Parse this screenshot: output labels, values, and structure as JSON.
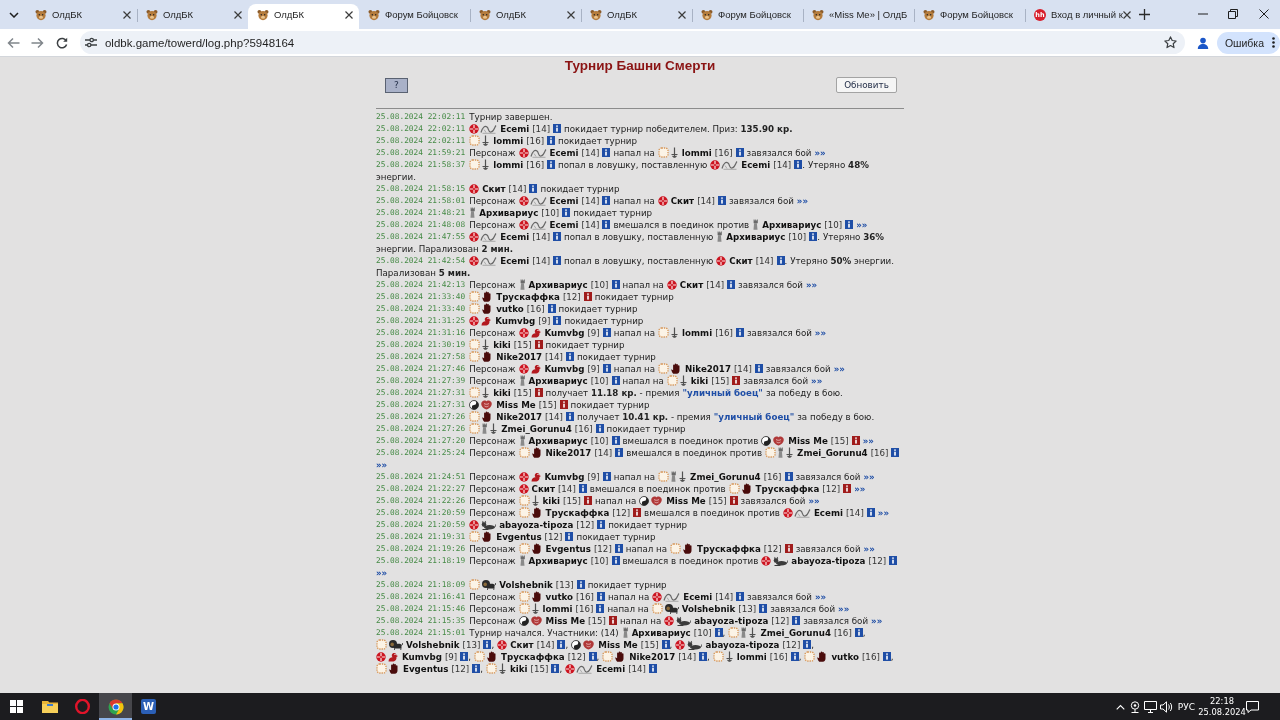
{
  "browser": {
    "tabs": [
      {
        "kind": "mascot",
        "title": "ОлдБК",
        "selected": false,
        "close": true
      },
      {
        "kind": "mascot",
        "title": "ОлдБК",
        "selected": false,
        "close": true
      },
      {
        "kind": "mascot",
        "title": "ОлдБК",
        "selected": true,
        "close": true
      },
      {
        "kind": "mascot",
        "title": "Форум Бойцовск",
        "selected": false,
        "close": false
      },
      {
        "kind": "mascot",
        "title": "ОлдБК",
        "selected": false,
        "close": true
      },
      {
        "kind": "mascot",
        "title": "ОлдБК",
        "selected": false,
        "close": true
      },
      {
        "kind": "mascot",
        "title": "Форум Бойцовск",
        "selected": false,
        "close": false
      },
      {
        "kind": "mascot",
        "title": "«Miss Me» | ОлдБ",
        "selected": false,
        "close": false
      },
      {
        "kind": "mascot",
        "title": "Форум Бойцовск",
        "selected": false,
        "close": false
      },
      {
        "kind": "badge",
        "logo": "hh",
        "title": "Вход в личный к",
        "selected": false,
        "close": true
      }
    ],
    "url": "oldbk.game/towerd/log.php?5948164",
    "profile_button": "Ошибка"
  },
  "page": {
    "title": "Турнир Башни Смерти",
    "help_button": "?",
    "refresh_button": "Обновить",
    "log": [
      {
        "time": "25.08.2024 22:02:11",
        "parts": [
          {
            "kind": "text",
            "text": "Турнир завершен."
          }
        ]
      },
      {
        "time": "25.08.2024 22:02:11",
        "parts": [
          {
            "kind": "player",
            "emblems": [
              {
                "kind": "cross"
              },
              {
                "kind": "venom"
              }
            ],
            "name": "Ecemi",
            "rank": "[14]",
            "color": "#1f4ea6"
          },
          {
            "kind": "text",
            "text": "покидает турнир победителем. Приз: **135.90 кр.**"
          }
        ]
      },
      {
        "time": "25.08.2024 22:02:11",
        "parts": [
          {
            "kind": "player",
            "emblems": [
              {
                "kind": "ring"
              },
              {
                "kind": "dagger"
              }
            ],
            "name": "lommi",
            "rank": "[16]",
            "color": "#1f4ea6"
          },
          {
            "kind": "text",
            "text": "покидает турнир"
          }
        ]
      },
      {
        "time": "25.08.2024 21:59:21",
        "parts": [
          {
            "kind": "text",
            "text": "Персонаж"
          },
          {
            "kind": "player",
            "emblems": [
              {
                "kind": "cross"
              },
              {
                "kind": "venom"
              }
            ],
            "name": "Ecemi",
            "rank": "[14]",
            "color": "#1f4ea6"
          },
          {
            "kind": "text",
            "text": "напал на"
          },
          {
            "kind": "player",
            "emblems": [
              {
                "kind": "ring"
              },
              {
                "kind": "dagger"
              }
            ],
            "name": "lommi",
            "rank": "[16]",
            "color": "#1f4ea6"
          },
          {
            "kind": "text",
            "text": "завязался бой"
          },
          {
            "kind": "link",
            "text": "»»"
          }
        ]
      },
      {
        "time": "25.08.2024 21:58:37",
        "parts": [
          {
            "kind": "player",
            "emblems": [
              {
                "kind": "ring"
              },
              {
                "kind": "dagger"
              }
            ],
            "name": "lommi",
            "rank": "[16]",
            "color": "#1f4ea6"
          },
          {
            "kind": "text",
            "text": "попал в ловушку, поставленную"
          },
          {
            "kind": "player",
            "emblems": [
              {
                "kind": "cross"
              },
              {
                "kind": "venom"
              }
            ],
            "name": "Ecemi",
            "rank": "[14]",
            "color": "#1f4ea6",
            "suffix": "."
          },
          {
            "kind": "text",
            "text": "Утеряно **48%**"
          },
          {
            "kind": "text",
            "text": "энергии."
          }
        ]
      },
      {
        "time": "25.08.2024 21:58:15",
        "parts": [
          {
            "kind": "player",
            "emblems": [
              {
                "kind": "cross"
              }
            ],
            "name": "Скит",
            "rank": "[14]",
            "color": "#1f4ea6"
          },
          {
            "kind": "text",
            "text": "покидает турнир"
          }
        ]
      },
      {
        "time": "25.08.2024 21:58:01",
        "parts": [
          {
            "kind": "text",
            "text": "Персонаж"
          },
          {
            "kind": "player",
            "emblems": [
              {
                "kind": "cross"
              },
              {
                "kind": "venom"
              }
            ],
            "name": "Ecemi",
            "rank": "[14]",
            "color": "#1f4ea6"
          },
          {
            "kind": "text",
            "text": "напал на"
          },
          {
            "kind": "player",
            "emblems": [
              {
                "kind": "cross"
              }
            ],
            "name": "Скит",
            "rank": "[14]",
            "color": "#1f4ea6"
          },
          {
            "kind": "text",
            "text": "завязался бой"
          },
          {
            "kind": "link",
            "text": "»»"
          }
        ]
      },
      {
        "time": "25.08.2024 21:48:21",
        "parts": [
          {
            "kind": "player",
            "emblems": [
              {
                "kind": "tower"
              }
            ],
            "name": "Архивариус",
            "rank": "[10]",
            "color": "#1f4ea6"
          },
          {
            "kind": "text",
            "text": "покидает турнир"
          }
        ]
      },
      {
        "time": "25.08.2024 21:48:08",
        "parts": [
          {
            "kind": "text",
            "text": "Персонаж"
          },
          {
            "kind": "player",
            "emblems": [
              {
                "kind": "cross"
              },
              {
                "kind": "venom"
              }
            ],
            "name": "Ecemi",
            "rank": "[14]",
            "color": "#1f4ea6"
          },
          {
            "kind": "text",
            "text": "вмешался в поединок против"
          },
          {
            "kind": "player",
            "emblems": [
              {
                "kind": "tower"
              }
            ],
            "name": "Архивариус",
            "rank": "[10]",
            "color": "#1f4ea6"
          },
          {
            "kind": "link",
            "text": "»»"
          }
        ]
      },
      {
        "time": "25.08.2024 21:47:55",
        "parts": [
          {
            "kind": "player",
            "emblems": [
              {
                "kind": "cross"
              },
              {
                "kind": "venom"
              }
            ],
            "name": "Ecemi",
            "rank": "[14]",
            "color": "#1f4ea6"
          },
          {
            "kind": "text",
            "text": "попал в ловушку, поставленную"
          },
          {
            "kind": "player",
            "emblems": [
              {
                "kind": "tower"
              }
            ],
            "name": "Архивариус",
            "rank": "[10]",
            "color": "#1f4ea6",
            "suffix": "."
          },
          {
            "kind": "text",
            "text": "Утеряно **36%**"
          },
          {
            "kind": "text",
            "text": "энергии. Парализован **2 мин.**"
          }
        ]
      },
      {
        "time": "25.08.2024 21:42:54",
        "parts": [
          {
            "kind": "player",
            "emblems": [
              {
                "kind": "cross"
              },
              {
                "kind": "venom"
              }
            ],
            "name": "Ecemi",
            "rank": "[14]",
            "color": "#1f4ea6"
          },
          {
            "kind": "text",
            "text": "попал в ловушку, поставленную"
          },
          {
            "kind": "player",
            "emblems": [
              {
                "kind": "cross"
              }
            ],
            "name": "Скит",
            "rank": "[14]",
            "color": "#1f4ea6",
            "suffix": "."
          },
          {
            "kind": "text",
            "text": "Утеряно **50%** энергии."
          },
          {
            "kind": "text",
            "text": "Парализован **5 мин.**"
          }
        ]
      },
      {
        "time": "25.08.2024 21:42:13",
        "parts": [
          {
            "kind": "text",
            "text": "Персонаж"
          },
          {
            "kind": "player",
            "emblems": [
              {
                "kind": "tower"
              }
            ],
            "name": "Архивариус",
            "rank": "[10]",
            "color": "#1f4ea6"
          },
          {
            "kind": "text",
            "text": "напал на"
          },
          {
            "kind": "player",
            "emblems": [
              {
                "kind": "cross"
              }
            ],
            "name": "Скит",
            "rank": "[14]",
            "color": "#1f4ea6"
          },
          {
            "kind": "text",
            "text": "завязался бой"
          },
          {
            "kind": "link",
            "text": "»»"
          }
        ]
      },
      {
        "time": "25.08.2024 21:33:40",
        "parts": [
          {
            "kind": "player",
            "emblems": [
              {
                "kind": "ring"
              },
              {
                "kind": "hand"
              }
            ],
            "name": "Трускаффка",
            "rank": "[12]",
            "color": "#a01c1c"
          },
          {
            "kind": "text",
            "text": "покидает турнир"
          }
        ]
      },
      {
        "time": "25.08.2024 21:33:40",
        "parts": [
          {
            "kind": "player",
            "emblems": [
              {
                "kind": "ring"
              },
              {
                "kind": "hand"
              }
            ],
            "name": "vutko",
            "rank": "[16]",
            "color": "#1f4ea6"
          },
          {
            "kind": "text",
            "text": "покидает турнир"
          }
        ]
      },
      {
        "time": "25.08.2024 21:31:25",
        "parts": [
          {
            "kind": "player",
            "emblems": [
              {
                "kind": "cross"
              },
              {
                "kind": "dragon"
              }
            ],
            "name": "Kumvbg",
            "rank": "[9]",
            "color": "#1f4ea6"
          },
          {
            "kind": "text",
            "text": "покидает турнир"
          }
        ]
      },
      {
        "time": "25.08.2024 21:31:16",
        "parts": [
          {
            "kind": "text",
            "text": "Персонаж"
          },
          {
            "kind": "player",
            "emblems": [
              {
                "kind": "cross"
              },
              {
                "kind": "dragon"
              }
            ],
            "name": "Kumvbg",
            "rank": "[9]",
            "color": "#1f4ea6"
          },
          {
            "kind": "text",
            "text": "напал на"
          },
          {
            "kind": "player",
            "emblems": [
              {
                "kind": "ring"
              },
              {
                "kind": "dagger"
              }
            ],
            "name": "lommi",
            "rank": "[16]",
            "color": "#1f4ea6"
          },
          {
            "kind": "text",
            "text": "завязался бой"
          },
          {
            "kind": "link",
            "text": "»»"
          }
        ]
      },
      {
        "time": "25.08.2024 21:30:19",
        "parts": [
          {
            "kind": "player",
            "emblems": [
              {
                "kind": "ring"
              },
              {
                "kind": "dagger"
              }
            ],
            "name": "kiki",
            "rank": "[15]",
            "color": "#a01c1c"
          },
          {
            "kind": "text",
            "text": "покидает турнир"
          }
        ]
      },
      {
        "time": "25.08.2024 21:27:58",
        "parts": [
          {
            "kind": "player",
            "emblems": [
              {
                "kind": "ring"
              },
              {
                "kind": "hand"
              }
            ],
            "name": "Nike2017",
            "rank": "[14]",
            "color": "#1f4ea6"
          },
          {
            "kind": "text",
            "text": "покидает турнир"
          }
        ]
      },
      {
        "time": "25.08.2024 21:27:46",
        "parts": [
          {
            "kind": "text",
            "text": "Персонаж"
          },
          {
            "kind": "player",
            "emblems": [
              {
                "kind": "cross"
              },
              {
                "kind": "dragon"
              }
            ],
            "name": "Kumvbg",
            "rank": "[9]",
            "color": "#1f4ea6"
          },
          {
            "kind": "text",
            "text": "напал на"
          },
          {
            "kind": "player",
            "emblems": [
              {
                "kind": "ring"
              },
              {
                "kind": "hand"
              }
            ],
            "name": "Nike2017",
            "rank": "[14]",
            "color": "#1f4ea6"
          },
          {
            "kind": "text",
            "text": "завязался бой"
          },
          {
            "kind": "link",
            "text": "»»"
          }
        ]
      },
      {
        "time": "25.08.2024 21:27:39",
        "parts": [
          {
            "kind": "text",
            "text": "Персонаж"
          },
          {
            "kind": "player",
            "emblems": [
              {
                "kind": "tower"
              }
            ],
            "name": "Архивариус",
            "rank": "[10]",
            "color": "#1f4ea6"
          },
          {
            "kind": "text",
            "text": "напал на"
          },
          {
            "kind": "player",
            "emblems": [
              {
                "kind": "ring"
              },
              {
                "kind": "dagger"
              }
            ],
            "name": "kiki",
            "rank": "[15]",
            "color": "#a01c1c"
          },
          {
            "kind": "text",
            "text": "завязался бой"
          },
          {
            "kind": "link",
            "text": "»»"
          }
        ]
      },
      {
        "time": "25.08.2024 21:27:31",
        "parts": [
          {
            "kind": "player",
            "emblems": [
              {
                "kind": "ring"
              },
              {
                "kind": "dagger"
              }
            ],
            "name": "kiki",
            "rank": "[15]",
            "color": "#a01c1c"
          },
          {
            "kind": "text",
            "text": "получает **11.18 кр.** - премия"
          },
          {
            "kind": "quote",
            "text": "\"уличный боец\""
          },
          {
            "kind": "text",
            "text": "за победу в бою."
          }
        ]
      },
      {
        "time": "25.08.2024 21:27:31",
        "parts": [
          {
            "kind": "player",
            "emblems": [
              {
                "kind": "yinyang"
              },
              {
                "kind": "crest"
              }
            ],
            "name": "Miss Me",
            "rank": "[15]",
            "color": "#a01c1c"
          },
          {
            "kind": "text",
            "text": "покидает турнир"
          }
        ]
      },
      {
        "time": "25.08.2024 21:27:26",
        "parts": [
          {
            "kind": "player",
            "emblems": [
              {
                "kind": "ring"
              },
              {
                "kind": "hand"
              }
            ],
            "name": "Nike2017",
            "rank": "[14]",
            "color": "#1f4ea6"
          },
          {
            "kind": "text",
            "text": "получает **10.41 кр.** - премия"
          },
          {
            "kind": "quote",
            "text": "\"уличный боец\""
          },
          {
            "kind": "text",
            "text": "за победу в бою."
          }
        ]
      },
      {
        "time": "25.08.2024 21:27:26",
        "parts": [
          {
            "kind": "player",
            "emblems": [
              {
                "kind": "ring"
              },
              {
                "kind": "tower"
              },
              {
                "kind": "dagger"
              }
            ],
            "name": "Zmei_Gorunu4",
            "rank": "[16]",
            "color": "#1f4ea6"
          },
          {
            "kind": "text",
            "text": "покидает турнир"
          }
        ]
      },
      {
        "time": "25.08.2024 21:27:20",
        "parts": [
          {
            "kind": "text",
            "text": "Персонаж"
          },
          {
            "kind": "player",
            "emblems": [
              {
                "kind": "tower"
              }
            ],
            "name": "Архивариус",
            "rank": "[10]",
            "color": "#1f4ea6"
          },
          {
            "kind": "text",
            "text": "вмешался в поединок против"
          },
          {
            "kind": "player",
            "emblems": [
              {
                "kind": "yinyang"
              },
              {
                "kind": "crest"
              }
            ],
            "name": "Miss Me",
            "rank": "[15]",
            "color": "#a01c1c"
          },
          {
            "kind": "link",
            "text": "»»"
          }
        ]
      },
      {
        "time": "25.08.2024 21:25:24",
        "parts": [
          {
            "kind": "text",
            "text": "Персонаж"
          },
          {
            "kind": "player",
            "emblems": [
              {
                "kind": "ring"
              },
              {
                "kind": "hand"
              }
            ],
            "name": "Nike2017",
            "rank": "[14]",
            "color": "#1f4ea6"
          },
          {
            "kind": "text",
            "text": "вмешался в поединок против"
          },
          {
            "kind": "player",
            "emblems": [
              {
                "kind": "ring"
              },
              {
                "kind": "tower"
              },
              {
                "kind": "dagger"
              }
            ],
            "name": "Zmei_Gorunu4",
            "rank": "[16]",
            "color": "#1f4ea6"
          },
          {
            "kind": "link",
            "text": "»»"
          }
        ]
      },
      {
        "time": "25.08.2024 21:24:51",
        "parts": [
          {
            "kind": "text",
            "text": "Персонаж"
          },
          {
            "kind": "player",
            "emblems": [
              {
                "kind": "cross"
              },
              {
                "kind": "dragon"
              }
            ],
            "name": "Kumvbg",
            "rank": "[9]",
            "color": "#1f4ea6"
          },
          {
            "kind": "text",
            "text": "напал на"
          },
          {
            "kind": "player",
            "emblems": [
              {
                "kind": "ring"
              },
              {
                "kind": "tower"
              },
              {
                "kind": "dagger"
              }
            ],
            "name": "Zmei_Gorunu4",
            "rank": "[16]",
            "color": "#1f4ea6"
          },
          {
            "kind": "text",
            "text": "завязался бой"
          },
          {
            "kind": "link",
            "text": "»»"
          }
        ]
      },
      {
        "time": "25.08.2024 21:22:27",
        "parts": [
          {
            "kind": "text",
            "text": "Персонаж"
          },
          {
            "kind": "player",
            "emblems": [
              {
                "kind": "cross"
              }
            ],
            "name": "Скит",
            "rank": "[14]",
            "color": "#1f4ea6"
          },
          {
            "kind": "text",
            "text": "вмешался в поединок против"
          },
          {
            "kind": "player",
            "emblems": [
              {
                "kind": "ring"
              },
              {
                "kind": "hand"
              }
            ],
            "name": "Трускаффка",
            "rank": "[12]",
            "color": "#a01c1c"
          },
          {
            "kind": "link",
            "text": "»»"
          }
        ]
      },
      {
        "time": "25.08.2024 21:22:26",
        "parts": [
          {
            "kind": "text",
            "text": "Персонаж"
          },
          {
            "kind": "player",
            "emblems": [
              {
                "kind": "ring"
              },
              {
                "kind": "dagger"
              }
            ],
            "name": "kiki",
            "rank": "[15]",
            "color": "#a01c1c"
          },
          {
            "kind": "text",
            "text": "напал на"
          },
          {
            "kind": "player",
            "emblems": [
              {
                "kind": "yinyang"
              },
              {
                "kind": "crest"
              }
            ],
            "name": "Miss Me",
            "rank": "[15]",
            "color": "#a01c1c"
          },
          {
            "kind": "text",
            "text": "завязался бой"
          },
          {
            "kind": "link",
            "text": "»»"
          }
        ]
      },
      {
        "time": "25.08.2024 21:20:59",
        "parts": [
          {
            "kind": "text",
            "text": "Персонаж"
          },
          {
            "kind": "player",
            "emblems": [
              {
                "kind": "ring"
              },
              {
                "kind": "hand"
              }
            ],
            "name": "Трускаффка",
            "rank": "[12]",
            "color": "#a01c1c"
          },
          {
            "kind": "text",
            "text": "вмешался в поединок против"
          },
          {
            "kind": "player",
            "emblems": [
              {
                "kind": "cross"
              },
              {
                "kind": "venom"
              }
            ],
            "name": "Ecemi",
            "rank": "[14]",
            "color": "#1f4ea6"
          },
          {
            "kind": "link",
            "text": "»»"
          }
        ]
      },
      {
        "time": "25.08.2024 21:20:59",
        "parts": [
          {
            "kind": "player",
            "emblems": [
              {
                "kind": "cross"
              },
              {
                "kind": "sphinx"
              }
            ],
            "name": "abayoza-tipoza",
            "rank": "[12]",
            "color": "#1f4ea6"
          },
          {
            "kind": "text",
            "text": "покидает турнир"
          }
        ]
      },
      {
        "time": "25.08.2024 21:19:31",
        "parts": [
          {
            "kind": "player",
            "emblems": [
              {
                "kind": "ring"
              },
              {
                "kind": "hand"
              }
            ],
            "name": "Evgentus",
            "rank": "[12]",
            "color": "#1f4ea6"
          },
          {
            "kind": "text",
            "text": "покидает турнир"
          }
        ]
      },
      {
        "time": "25.08.2024 21:19:26",
        "parts": [
          {
            "kind": "text",
            "text": "Персонаж"
          },
          {
            "kind": "player",
            "emblems": [
              {
                "kind": "ring"
              },
              {
                "kind": "hand"
              }
            ],
            "name": "Evgentus",
            "rank": "[12]",
            "color": "#1f4ea6"
          },
          {
            "kind": "text",
            "text": "напал на"
          },
          {
            "kind": "player",
            "emblems": [
              {
                "kind": "ring"
              },
              {
                "kind": "hand"
              }
            ],
            "name": "Трускаффка",
            "rank": "[12]",
            "color": "#a01c1c"
          },
          {
            "kind": "text",
            "text": "завязался бой"
          },
          {
            "kind": "link",
            "text": "»»"
          }
        ]
      },
      {
        "time": "25.08.2024 21:18:19",
        "parts": [
          {
            "kind": "text",
            "text": "Персонаж"
          },
          {
            "kind": "player",
            "emblems": [
              {
                "kind": "tower"
              }
            ],
            "name": "Архивариус",
            "rank": "[10]",
            "color": "#1f4ea6"
          },
          {
            "kind": "text",
            "text": "вмешался в поединок против"
          },
          {
            "kind": "player",
            "emblems": [
              {
                "kind": "cross"
              },
              {
                "kind": "sphinx"
              }
            ],
            "name": "abayoza-tipoza",
            "rank": "[12]",
            "color": "#1f4ea6"
          },
          {
            "kind": "link",
            "text": "»»"
          }
        ]
      },
      {
        "time": "25.08.2024 21:18:09",
        "parts": [
          {
            "kind": "player",
            "emblems": [
              {
                "kind": "ring"
              },
              {
                "kind": "lion"
              }
            ],
            "name": "Volshebnik",
            "rank": "[13]",
            "color": "#1f4ea6"
          },
          {
            "kind": "text",
            "text": "покидает турнир"
          }
        ]
      },
      {
        "time": "25.08.2024 21:16:41",
        "parts": [
          {
            "kind": "text",
            "text": "Персонаж"
          },
          {
            "kind": "player",
            "emblems": [
              {
                "kind": "ring"
              },
              {
                "kind": "hand"
              }
            ],
            "name": "vutko",
            "rank": "[16]",
            "color": "#1f4ea6"
          },
          {
            "kind": "text",
            "text": "напал на"
          },
          {
            "kind": "player",
            "emblems": [
              {
                "kind": "cross"
              },
              {
                "kind": "venom"
              }
            ],
            "name": "Ecemi",
            "rank": "[14]",
            "color": "#1f4ea6"
          },
          {
            "kind": "text",
            "text": "завязался бой"
          },
          {
            "kind": "link",
            "text": "»»"
          }
        ]
      },
      {
        "time": "25.08.2024 21:15:46",
        "parts": [
          {
            "kind": "text",
            "text": "Персонаж"
          },
          {
            "kind": "player",
            "emblems": [
              {
                "kind": "ring"
              },
              {
                "kind": "dagger"
              }
            ],
            "name": "lommi",
            "rank": "[16]",
            "color": "#1f4ea6"
          },
          {
            "kind": "text",
            "text": "напал на"
          },
          {
            "kind": "player",
            "emblems": [
              {
                "kind": "ring"
              },
              {
                "kind": "lion"
              }
            ],
            "name": "Volshebnik",
            "rank": "[13]",
            "color": "#1f4ea6"
          },
          {
            "kind": "text",
            "text": "завязался бой"
          },
          {
            "kind": "link",
            "text": "»»"
          }
        ]
      },
      {
        "time": "25.08.2024 21:15:35",
        "parts": [
          {
            "kind": "text",
            "text": "Персонаж"
          },
          {
            "kind": "player",
            "emblems": [
              {
                "kind": "yinyang"
              },
              {
                "kind": "crest"
              }
            ],
            "name": "Miss Me",
            "rank": "[15]",
            "color": "#a01c1c"
          },
          {
            "kind": "text",
            "text": "напал на"
          },
          {
            "kind": "player",
            "emblems": [
              {
                "kind": "cross"
              },
              {
                "kind": "sphinx"
              }
            ],
            "name": "abayoza-tipoza",
            "rank": "[12]",
            "color": "#1f4ea6"
          },
          {
            "kind": "text",
            "text": "завязался бой"
          },
          {
            "kind": "link",
            "text": "»»"
          }
        ]
      },
      {
        "time": "25.08.2024 21:15:01",
        "parts": [
          {
            "kind": "text",
            "text": "Турнир начался. Участники: (14)"
          },
          {
            "kind": "player",
            "emblems": [
              {
                "kind": "tower"
              }
            ],
            "name": "Архивариус",
            "rank": "[10]",
            "color": "#1f4ea6",
            "suffix": ","
          },
          {
            "kind": "player",
            "emblems": [
              {
                "kind": "ring"
              },
              {
                "kind": "tower"
              },
              {
                "kind": "dagger"
              }
            ],
            "name": "Zmei_Gorunu4",
            "rank": "[16]",
            "color": "#1f4ea6",
            "suffix": ","
          },
          {
            "kind": "player",
            "emblems": [
              {
                "kind": "ring"
              },
              {
                "kind": "lion"
              }
            ],
            "name": "Volshebnik",
            "rank": "[13]",
            "color": "#1f4ea6",
            "suffix": ","
          },
          {
            "kind": "player",
            "emblems": [
              {
                "kind": "cross"
              }
            ],
            "name": "Скит",
            "rank": "[14]",
            "color": "#1f4ea6",
            "suffix": ","
          },
          {
            "kind": "player",
            "emblems": [
              {
                "kind": "yinyang"
              },
              {
                "kind": "crest"
              }
            ],
            "name": "Miss Me",
            "rank": "[15]",
            "color": "#1f4ea6",
            "suffix": ","
          },
          {
            "kind": "player",
            "emblems": [
              {
                "kind": "cross"
              },
              {
                "kind": "sphinx"
              }
            ],
            "name": "abayoza-tipoza",
            "rank": "[12]",
            "color": "#1f4ea6",
            "suffix": ","
          },
          {
            "kind": "player",
            "emblems": [
              {
                "kind": "cross"
              },
              {
                "kind": "dragon"
              }
            ],
            "name": "Kumvbg",
            "rank": "[9]",
            "color": "#1f4ea6",
            "suffix": ","
          },
          {
            "kind": "player",
            "emblems": [
              {
                "kind": "ring"
              },
              {
                "kind": "hand"
              }
            ],
            "name": "Трускаффка",
            "rank": "[12]",
            "color": "#1f4ea6",
            "suffix": ","
          },
          {
            "kind": "player",
            "emblems": [
              {
                "kind": "ring"
              },
              {
                "kind": "hand"
              }
            ],
            "name": "Nike2017",
            "rank": "[14]",
            "color": "#1f4ea6",
            "suffix": ","
          },
          {
            "kind": "player",
            "emblems": [
              {
                "kind": "ring"
              },
              {
                "kind": "dagger"
              }
            ],
            "name": "lommi",
            "rank": "[16]",
            "color": "#1f4ea6",
            "suffix": ","
          },
          {
            "kind": "player",
            "emblems": [
              {
                "kind": "ring"
              },
              {
                "kind": "hand"
              }
            ],
            "name": "vutko",
            "rank": "[16]",
            "color": "#1f4ea6",
            "suffix": ","
          },
          {
            "kind": "player",
            "emblems": [
              {
                "kind": "ring"
              },
              {
                "kind": "hand"
              }
            ],
            "name": "Evgentus",
            "rank": "[12]",
            "color": "#1f4ea6",
            "suffix": ","
          },
          {
            "kind": "player",
            "emblems": [
              {
                "kind": "ring"
              },
              {
                "kind": "dagger"
              }
            ],
            "name": "kiki",
            "rank": "[15]",
            "color": "#1f4ea6",
            "suffix": ","
          },
          {
            "kind": "player",
            "emblems": [
              {
                "kind": "cross"
              },
              {
                "kind": "venom"
              }
            ],
            "name": "Ecemi",
            "rank": "[14]",
            "color": "#1f4ea6"
          }
        ]
      }
    ]
  },
  "taskbar": {
    "apps": [
      {
        "kind": "explorer",
        "active": false
      },
      {
        "kind": "opera",
        "active": false
      },
      {
        "kind": "chrome",
        "active": true
      },
      {
        "kind": "word",
        "logo": "W",
        "active": false
      }
    ],
    "language": "РУС",
    "time": "22:18",
    "date": "25.08.2024"
  }
}
